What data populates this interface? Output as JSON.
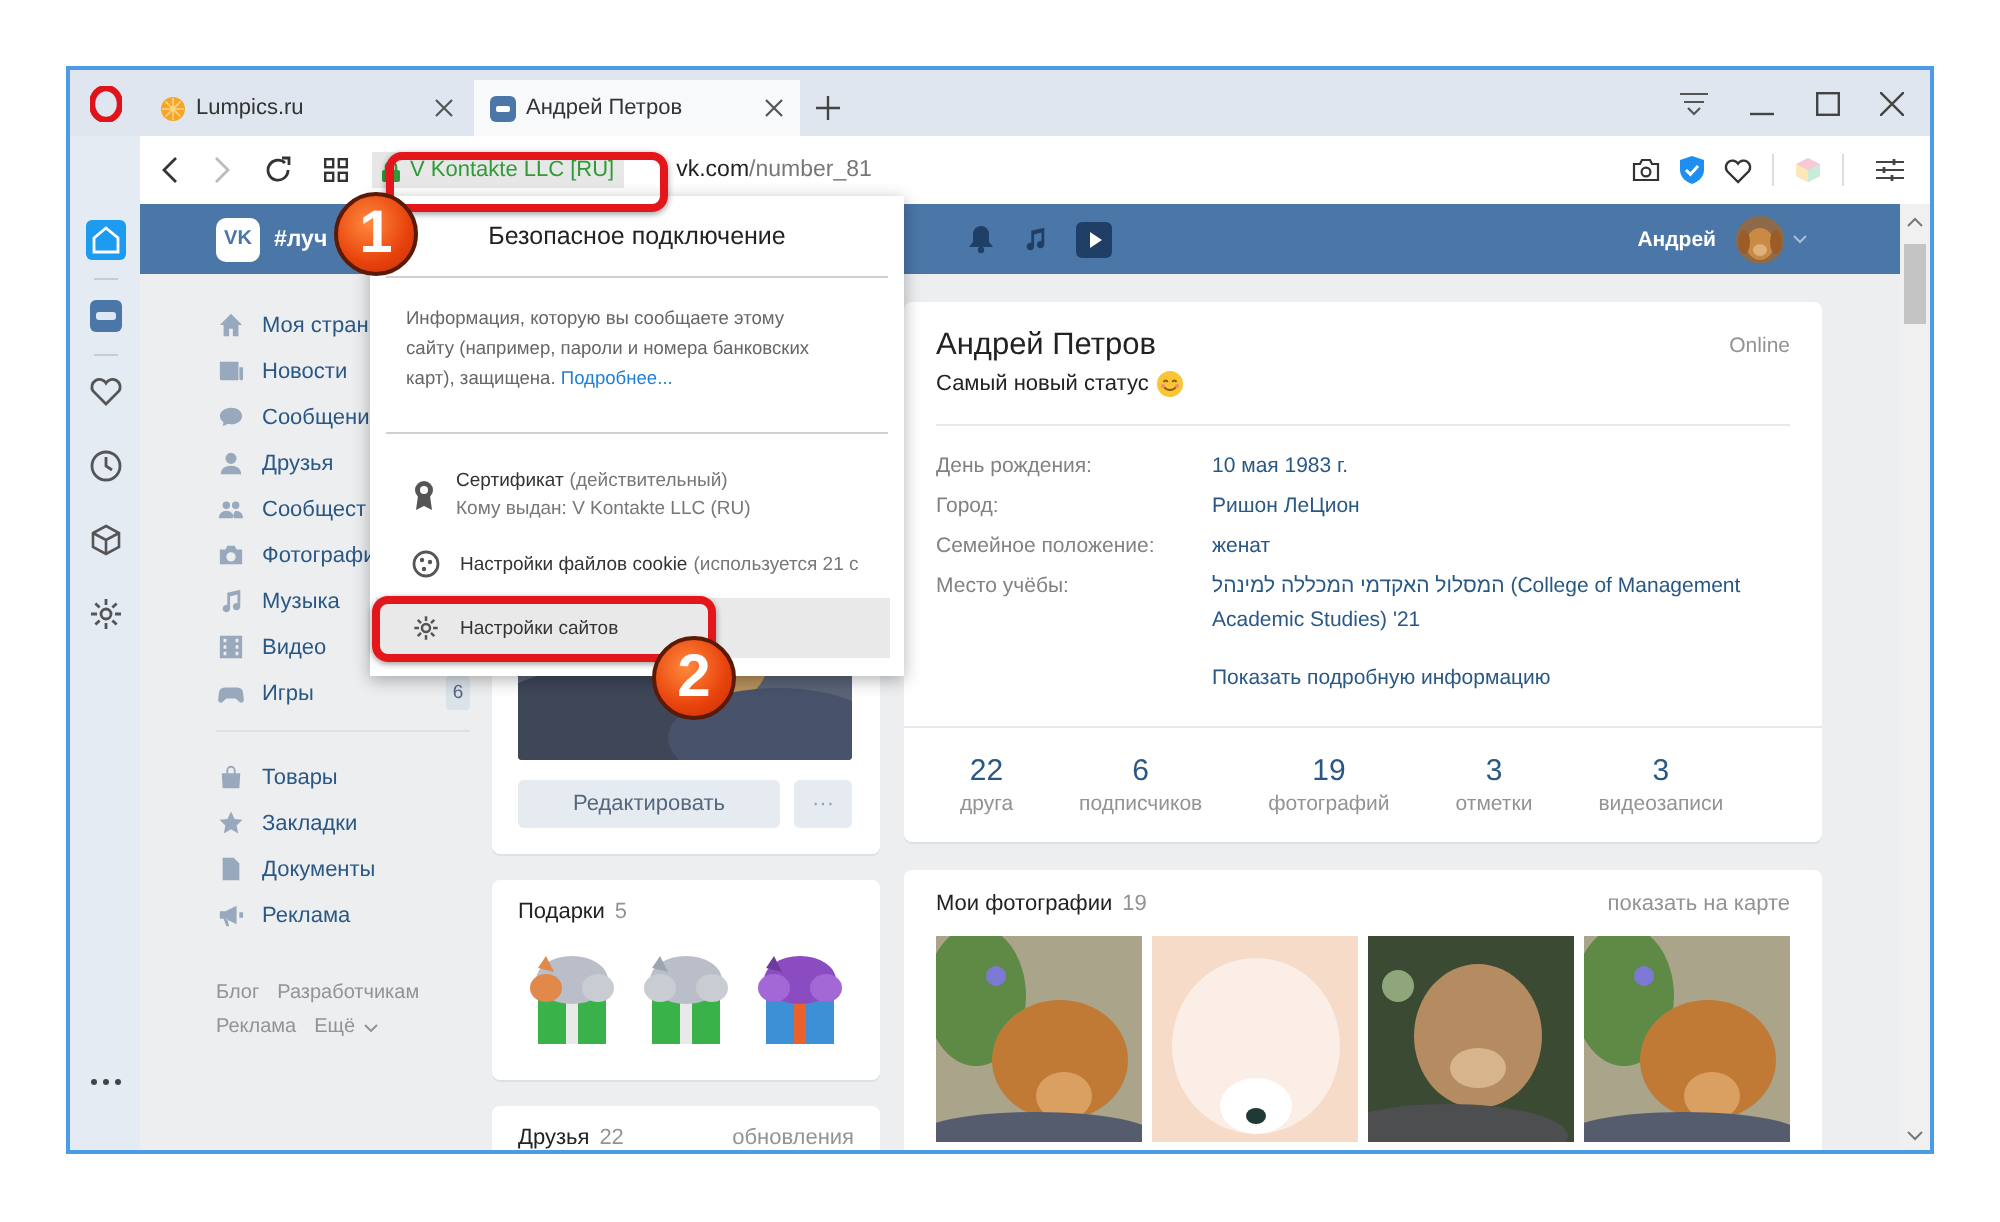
{
  "browser": {
    "tabs": [
      {
        "title": "Lumpics.ru",
        "selected": false
      },
      {
        "title": "Андрей Петров",
        "selected": true
      }
    ],
    "address": {
      "site_identity": "V Kontakte LLC [RU]",
      "url_host": "vk.com",
      "url_path": "/number_81"
    }
  },
  "opera_sidebar": [
    {
      "selected": true
    },
    {
      "selected": false
    },
    {
      "selected": false
    },
    {
      "selected": false
    },
    {
      "selected": false
    },
    {
      "selected": false
    }
  ],
  "vk_header": {
    "logo": "VK",
    "hashtag": "#луч",
    "user_name": "Андрей"
  },
  "left_nav": {
    "main": [
      {
        "label": "Моя стран"
      },
      {
        "label": "Новости"
      },
      {
        "label": "Сообщени"
      },
      {
        "label": "Друзья"
      },
      {
        "label": "Сообщест"
      },
      {
        "label": "Фотографи"
      },
      {
        "label": "Музыка"
      },
      {
        "label": "Видео"
      },
      {
        "label": "Игры",
        "count": "6"
      }
    ],
    "extra": [
      {
        "label": "Товары"
      },
      {
        "label": "Закладки"
      },
      {
        "label": "Документы"
      },
      {
        "label": "Реклама"
      }
    ],
    "footer_links": [
      "Блог",
      "Разработчикам",
      "Реклама",
      "Ещё"
    ]
  },
  "avatar_card": {
    "edit_button": "Редактировать",
    "more_button": "···"
  },
  "gifts": {
    "title": "Подарки",
    "count": "5"
  },
  "friends": {
    "title": "Друзья",
    "count": "22",
    "link": "обновления"
  },
  "profile": {
    "name": "Андрей Петров",
    "status": "Самый новый статус",
    "online": "Online",
    "fields": [
      {
        "label": "День рождения:",
        "value": "10 мая 1983 г."
      },
      {
        "label": "Город:",
        "value": "Ришон ЛеЦион"
      },
      {
        "label": "Семейное положение:",
        "value": "женат"
      },
      {
        "label": "Место учёбы:",
        "value": "המסלול האקדמי המכללה למינהל (College of Management Academic Studies) '21"
      }
    ],
    "more_link": "Показать подробную информацию",
    "counters": [
      {
        "value": "22",
        "label": "друга"
      },
      {
        "value": "6",
        "label": "подписчиков"
      },
      {
        "value": "19",
        "label": "фотографий"
      },
      {
        "value": "3",
        "label": "отметки"
      },
      {
        "value": "3",
        "label": "видеозаписи"
      }
    ]
  },
  "photos": {
    "title": "Мои фотографии",
    "count": "19",
    "map_link": "показать на карте"
  },
  "security_popup": {
    "title": "Безопасное подключение",
    "info": "Информация, которую вы сообщаете этому сайту (например, пароли и номера банковских карт), защищена.",
    "more_link": "Подробнее...",
    "rows": [
      {
        "kind": "certificate",
        "title": "Сертификат",
        "note": "(действительный)",
        "subtitle": "Кому выдан: V Kontakte LLC (RU)",
        "selected": false
      },
      {
        "kind": "cookies",
        "title": "Настройки файлов cookie",
        "note": "(используется 21 с",
        "selected": false
      },
      {
        "kind": "site-settings",
        "title": "Настройки сайтов",
        "selected": true
      }
    ]
  },
  "annotations": [
    {
      "number": "1"
    },
    {
      "number": "2"
    }
  ]
}
